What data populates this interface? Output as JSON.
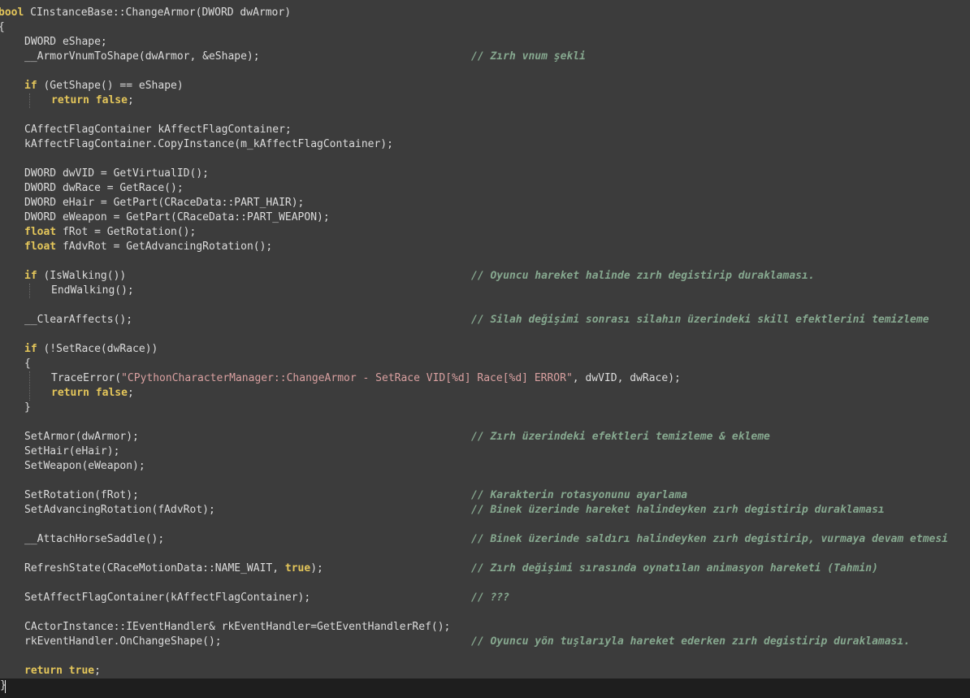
{
  "lines": [
    {
      "t": "bool CInstanceBase::ChangeArmor(DWORD dwArmor)",
      "kw": "bool"
    },
    {
      "t": "{"
    },
    {
      "t": "DWORD eShape;"
    },
    {
      "t": "__ArmorVnumToShape(dwArmor, &eShape);",
      "c": "// Zırh vnum şekli"
    },
    {
      "t": ""
    },
    {
      "t": "if (GetShape() == eShape)",
      "kw": "if"
    },
    {
      "t": "return false;",
      "kw": "return false"
    },
    {
      "t": ""
    },
    {
      "t": "CAffectFlagContainer kAffectFlagContainer;"
    },
    {
      "t": "kAffectFlagContainer.CopyInstance(m_kAffectFlagContainer);"
    },
    {
      "t": ""
    },
    {
      "t": "DWORD dwVID = GetVirtualID();"
    },
    {
      "t": "DWORD dwRace = GetRace();"
    },
    {
      "t": "DWORD eHair = GetPart(CRaceData::PART_HAIR);"
    },
    {
      "t": "DWORD eWeapon = GetPart(CRaceData::PART_WEAPON);"
    },
    {
      "t": "float fRot = GetRotation();",
      "kw": "float"
    },
    {
      "t": "float fAdvRot = GetAdvancingRotation();",
      "kw": "float"
    },
    {
      "t": ""
    },
    {
      "t": "if (IsWalking())",
      "kw": "if",
      "c": "// Oyuncu hareket halinde zırh degistirip duraklaması."
    },
    {
      "t": "EndWalking();"
    },
    {
      "t": ""
    },
    {
      "t": "__ClearAffects();",
      "c": "// Silah değişimi sonrası silahın üzerindeki skill efektlerini temizleme"
    },
    {
      "t": ""
    },
    {
      "t": "if (!SetRace(dwRace))",
      "kw": "if"
    },
    {
      "t": "{"
    },
    {
      "t": "TraceError(\"CPythonCharacterManager::ChangeArmor - SetRace VID[%d] Race[%d] ERROR\", dwVID, dwRace);"
    },
    {
      "t": "return false;",
      "kw": "return false"
    },
    {
      "t": "}"
    },
    {
      "t": ""
    },
    {
      "t": "SetArmor(dwArmor);",
      "c": "// Zırh üzerindeki efektleri temizleme & ekleme"
    },
    {
      "t": "SetHair(eHair);"
    },
    {
      "t": "SetWeapon(eWeapon);"
    },
    {
      "t": ""
    },
    {
      "t": "SetRotation(fRot);",
      "c": "// Karakterin rotasyonunu ayarlama"
    },
    {
      "t": "SetAdvancingRotation(fAdvRot);",
      "c": "// Binek üzerinde hareket halindeyken zırh degistirip duraklaması"
    },
    {
      "t": ""
    },
    {
      "t": "__AttachHorseSaddle();",
      "c": "// Binek üzerinde saldırı halindeyken zırh degistirip, vurmaya devam etmesi"
    },
    {
      "t": ""
    },
    {
      "t": "RefreshState(CRaceMotionData::NAME_WAIT, true);",
      "kw": "true",
      "c": "// Zırh değişimi sırasında oynatılan animasyon hareketi (Tahmin)"
    },
    {
      "t": ""
    },
    {
      "t": "SetAffectFlagContainer(kAffectFlagContainer);",
      "c": "// ???"
    },
    {
      "t": ""
    },
    {
      "t": "CActorInstance::IEventHandler& rkEventHandler=GetEventHandlerRef();"
    },
    {
      "t": "rkEventHandler.OnChangeShape();",
      "c": "// Oyuncu yön tuşlarıyla hareket ederken zırh degistirip duraklaması."
    },
    {
      "t": ""
    },
    {
      "t": "return true;",
      "kw": "return true"
    }
  ],
  "last_line": "}",
  "colors": {
    "background": "#3c3c3c",
    "text": "#dcdcdc",
    "keyword": "#e4c65a",
    "comment": "#86a88f",
    "string": "#d9a0a0"
  }
}
